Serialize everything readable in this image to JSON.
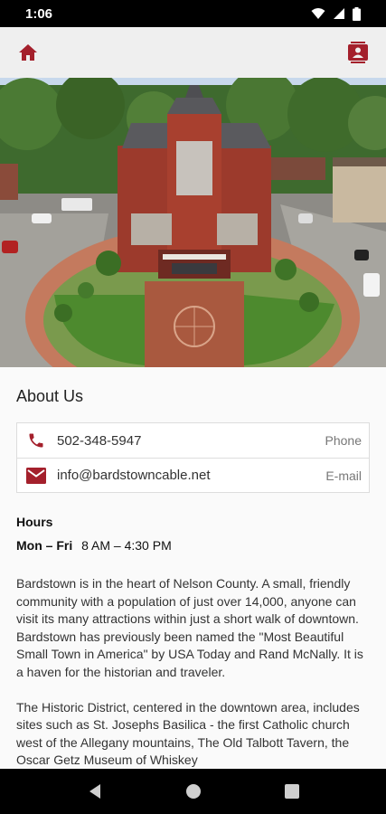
{
  "status_bar": {
    "time": "1:06",
    "icons": [
      "wifi-icon",
      "signal-icon",
      "battery-icon"
    ]
  },
  "app_bar": {
    "left_icon": "home-icon",
    "right_icon": "contact-card-icon"
  },
  "colors": {
    "accent": "#a4202c",
    "app_bar_bg": "#efefef",
    "background": "#fafafa"
  },
  "hero": {
    "image": "aerial view of red-brick courthouse in town square"
  },
  "about": {
    "title": "About Us",
    "contacts": [
      {
        "icon": "phone-icon",
        "value": "502-348-5947",
        "type": "Phone"
      },
      {
        "icon": "email-icon",
        "value": "info@bardstowncable.net",
        "type": "E-mail"
      }
    ],
    "hours_title": "Hours",
    "hours": {
      "days": "Mon – Fri",
      "time": "8 AM – 4:30 PM"
    },
    "paragraphs": [
      "Bardstown is in the heart of Nelson County. A small, friendly community with a population of just over 14,000, anyone can visit its many attractions within just a short walk of downtown. Bardstown has previously been named the \"Most Beautiful Small Town in America\" by USA Today and Rand McNally. It is a haven for the historian and traveler.",
      "The Historic District, centered in the downtown area, includes sites such as St. Josephs Basilica - the first Catholic church west of the Allegany mountains, The Old Talbott Tavern, the Oscar Getz Museum of Whiskey"
    ]
  },
  "nav_bar": {
    "buttons": [
      "back-icon",
      "home-circle-icon",
      "recents-icon"
    ]
  }
}
